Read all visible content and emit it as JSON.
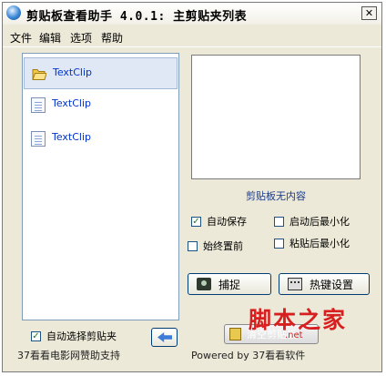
{
  "window": {
    "title": "剪贴板查看助手 4.0.1:  主剪贴夹列表",
    "close_glyph": "✕"
  },
  "menu": [
    "文件",
    "编辑",
    "选项",
    "帮助"
  ],
  "clips": [
    {
      "label": "TextClip",
      "selected": true,
      "icon": "folder-icon"
    },
    {
      "label": "TextClip",
      "selected": false,
      "icon": "document-icon"
    },
    {
      "label": "TextClip",
      "selected": false,
      "icon": "document-icon"
    }
  ],
  "preview": {
    "empty_label": "剪贴板无内容"
  },
  "options": {
    "auto_save": {
      "label": "自动保存",
      "checked": true
    },
    "minimize_on_start": {
      "label": "启动后最小化",
      "checked": false
    },
    "always_on_top": {
      "label": "始终置前",
      "checked": false
    },
    "minimize_after_paste": {
      "label": "粘贴后最小化",
      "checked": false
    },
    "auto_select_clip": {
      "label": "自动选择剪贴夹",
      "checked": true
    }
  },
  "buttons": {
    "capture": "捕捉",
    "hotkey": "热键设置",
    "clear": "清空剪贴板"
  },
  "status": {
    "left": "37看看电影网赞助支持",
    "right": "Powered by 37看看软件"
  },
  "watermark": {
    "main": "脚本之家",
    "sub": ".net"
  },
  "colors": {
    "selection": "#dfe8f4",
    "link_text": "#0033cc",
    "watermark": "#d81e1e"
  }
}
